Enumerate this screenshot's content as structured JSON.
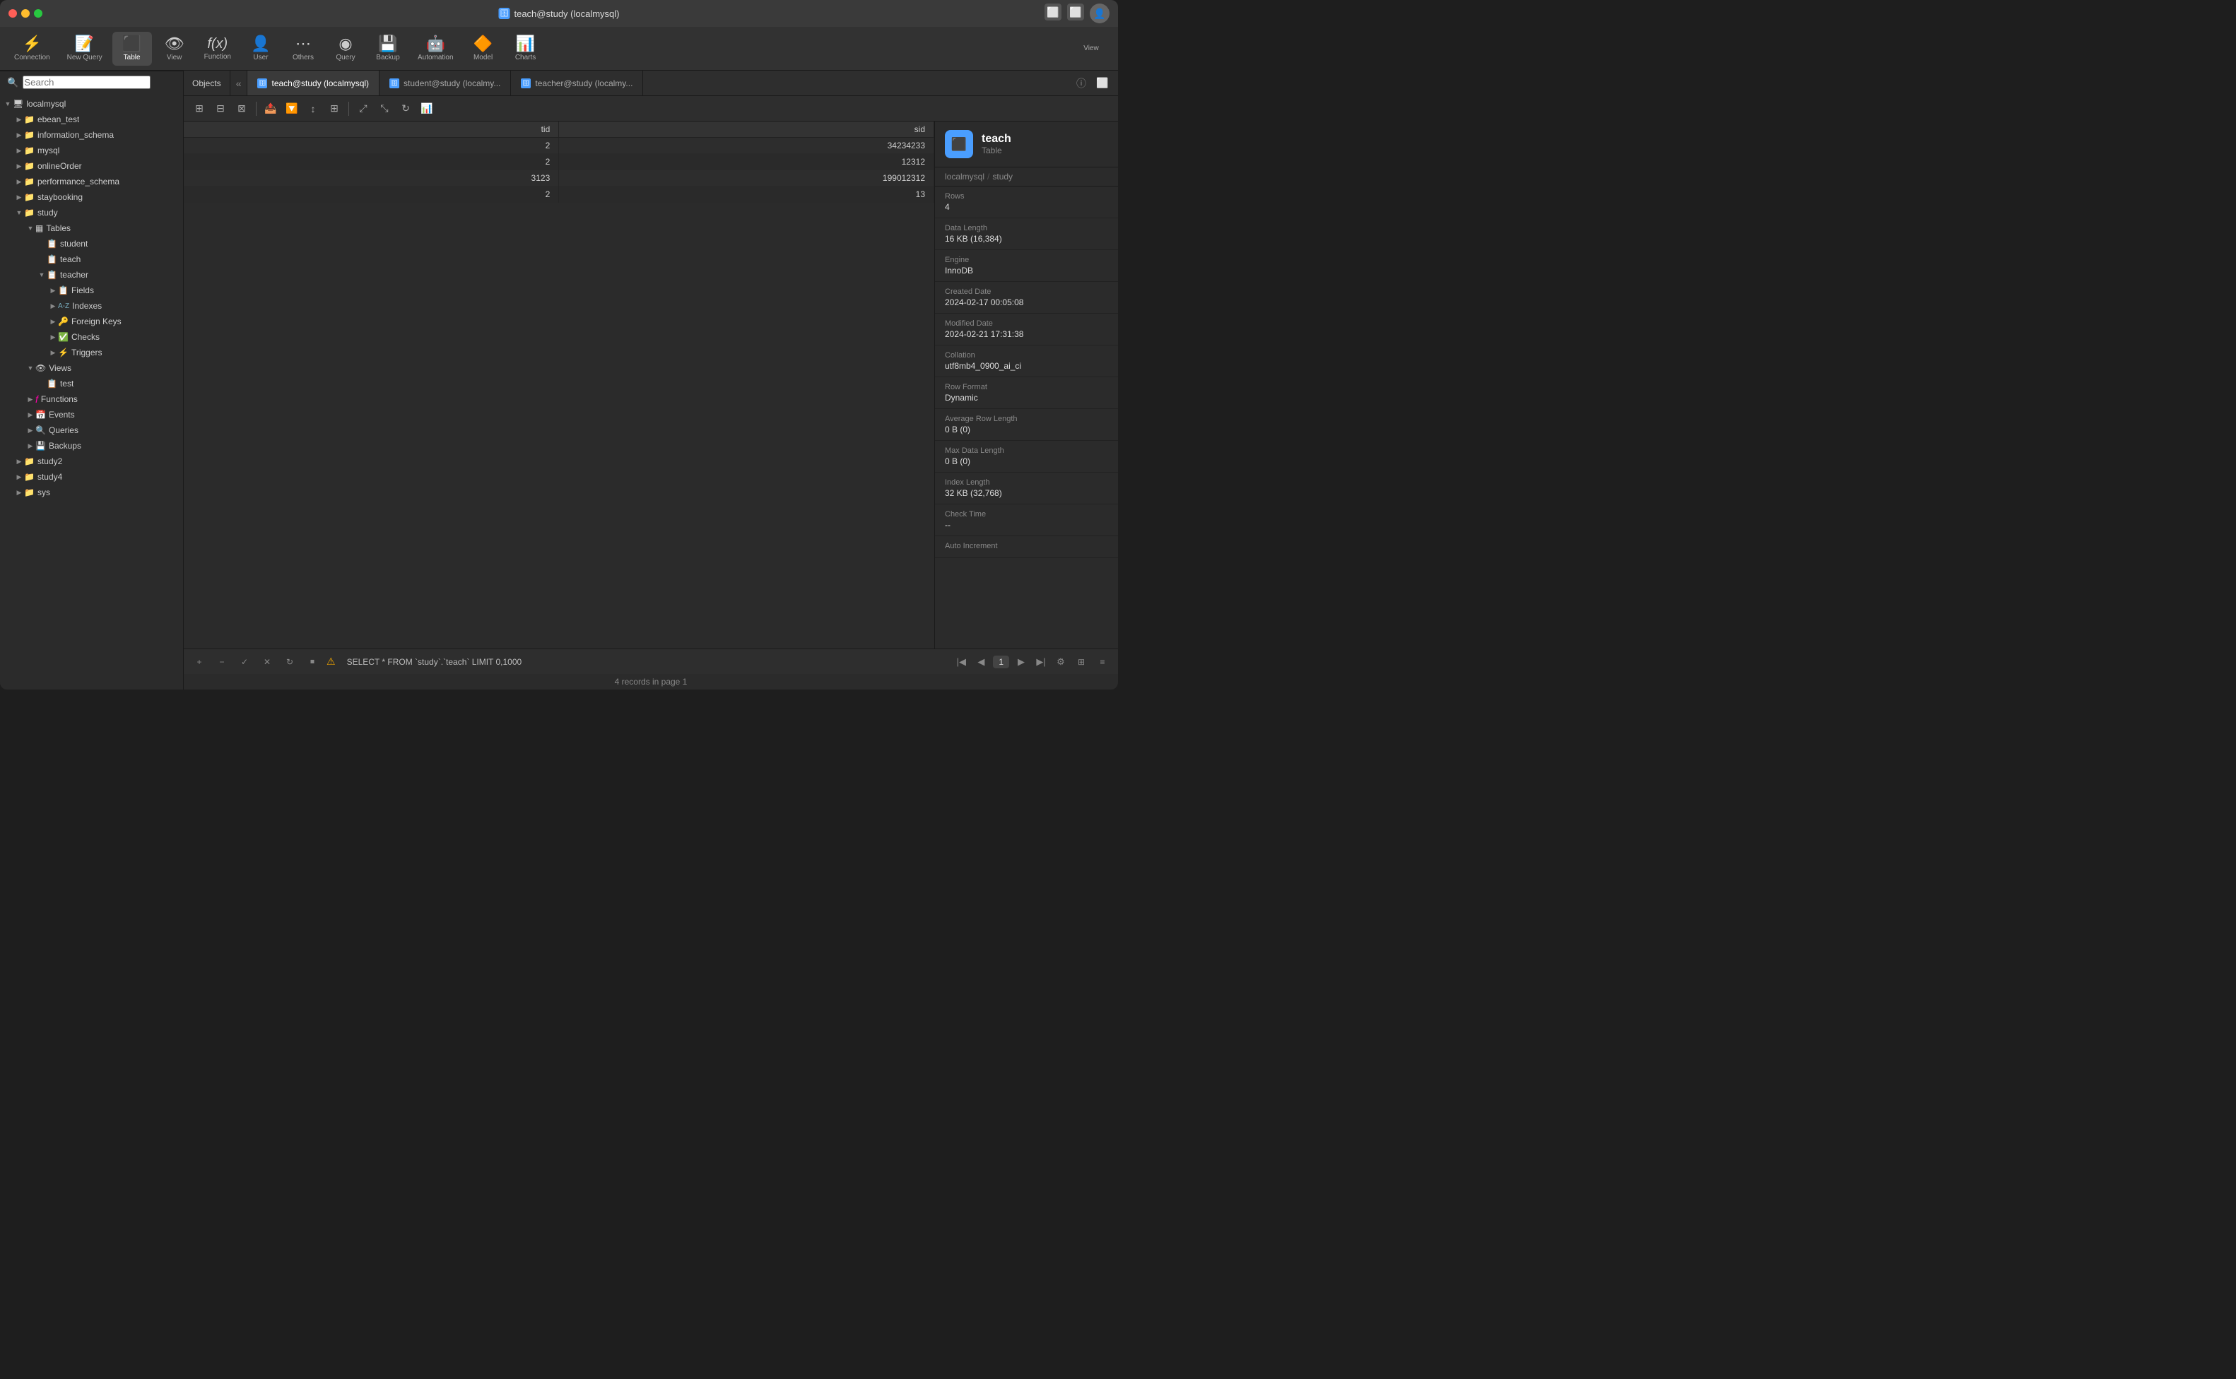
{
  "window": {
    "title": "teach@study (localmysql)"
  },
  "toolbar": {
    "items": [
      {
        "id": "connection",
        "label": "Connection",
        "icon": "⚡"
      },
      {
        "id": "new-query",
        "label": "New Query",
        "icon": "📝"
      },
      {
        "id": "table",
        "label": "Table",
        "icon": "▦",
        "active": true
      },
      {
        "id": "view",
        "label": "View",
        "icon": "👁"
      },
      {
        "id": "function",
        "label": "Function",
        "icon": "ƒ"
      },
      {
        "id": "user",
        "label": "User",
        "icon": "👤"
      },
      {
        "id": "others",
        "label": "Others",
        "icon": "⋯"
      },
      {
        "id": "query",
        "label": "Query",
        "icon": "◉"
      },
      {
        "id": "backup",
        "label": "Backup",
        "icon": "💾"
      },
      {
        "id": "automation",
        "label": "Automation",
        "icon": "🤖"
      },
      {
        "id": "model",
        "label": "Model",
        "icon": "🔶"
      },
      {
        "id": "charts",
        "label": "Charts",
        "icon": "📊"
      }
    ],
    "view_label": "View"
  },
  "tabs": {
    "objects_label": "Objects",
    "tabs": [
      {
        "id": "teach-study",
        "label": "teach@study (localmysql)",
        "active": true
      },
      {
        "id": "student-study",
        "label": "student@study (localmy..."
      },
      {
        "id": "teacher-study",
        "label": "teacher@study (localmy..."
      }
    ]
  },
  "sidebar": {
    "search_placeholder": "Search",
    "items": [
      {
        "id": "localmysql",
        "label": "localmysql",
        "level": 0,
        "expanded": true,
        "icon": "🖥"
      },
      {
        "id": "ebean_test",
        "label": "ebean_test",
        "level": 1,
        "expanded": false,
        "icon": "📁"
      },
      {
        "id": "information_schema",
        "label": "information_schema",
        "level": 1,
        "expanded": false,
        "icon": "📁"
      },
      {
        "id": "mysql",
        "label": "mysql",
        "level": 1,
        "expanded": false,
        "icon": "📁"
      },
      {
        "id": "onlineOrder",
        "label": "onlineOrder",
        "level": 1,
        "expanded": false,
        "icon": "📁"
      },
      {
        "id": "performance_schema",
        "label": "performance_schema",
        "level": 1,
        "expanded": false,
        "icon": "📁"
      },
      {
        "id": "staybooking",
        "label": "staybooking",
        "level": 1,
        "expanded": false,
        "icon": "📁"
      },
      {
        "id": "study",
        "label": "study",
        "level": 1,
        "expanded": true,
        "icon": "📁"
      },
      {
        "id": "tables",
        "label": "Tables",
        "level": 2,
        "expanded": true,
        "icon": "▦"
      },
      {
        "id": "student",
        "label": "student",
        "level": 3,
        "icon": "📋"
      },
      {
        "id": "teach",
        "label": "teach",
        "level": 3,
        "icon": "📋"
      },
      {
        "id": "teacher",
        "label": "teacher",
        "level": 3,
        "expanded": true,
        "icon": "📋"
      },
      {
        "id": "fields",
        "label": "Fields",
        "level": 4,
        "icon": "📋"
      },
      {
        "id": "indexes",
        "label": "Indexes",
        "level": 4,
        "icon": "🔤"
      },
      {
        "id": "foreign-keys",
        "label": "Foreign Keys",
        "level": 4,
        "icon": "🔑"
      },
      {
        "id": "checks",
        "label": "Checks",
        "level": 4,
        "icon": "✅"
      },
      {
        "id": "triggers",
        "label": "Triggers",
        "level": 4,
        "icon": "⚡"
      },
      {
        "id": "views",
        "label": "Views",
        "level": 2,
        "expanded": true,
        "icon": "👁"
      },
      {
        "id": "test",
        "label": "test",
        "level": 3,
        "icon": "📋"
      },
      {
        "id": "functions",
        "label": "Functions",
        "level": 2,
        "icon": "ƒ"
      },
      {
        "id": "events",
        "label": "Events",
        "level": 2,
        "icon": "📅"
      },
      {
        "id": "queries",
        "label": "Queries",
        "level": 2,
        "icon": "🔍"
      },
      {
        "id": "backups",
        "label": "Backups",
        "level": 2,
        "icon": "💾"
      },
      {
        "id": "study2",
        "label": "study2",
        "level": 1,
        "icon": "📁"
      },
      {
        "id": "study4",
        "label": "study4",
        "level": 1,
        "icon": "📁"
      },
      {
        "id": "sys",
        "label": "sys",
        "level": 1,
        "icon": "📁"
      }
    ]
  },
  "table": {
    "columns": [
      "tid",
      "sid"
    ],
    "rows": [
      {
        "tid": "2",
        "sid": "34234233"
      },
      {
        "tid": "2",
        "sid": "12312"
      },
      {
        "tid": "3123",
        "sid": "199012312"
      },
      {
        "tid": "2",
        "sid": "13"
      }
    ]
  },
  "info_panel": {
    "table_name": "teach",
    "table_type": "Table",
    "server": "localmysql",
    "database": "study",
    "rows_label": "Rows",
    "rows_value": "4",
    "data_length_label": "Data Length",
    "data_length_value": "16 KB (16,384)",
    "engine_label": "Engine",
    "engine_value": "InnoDB",
    "created_date_label": "Created Date",
    "created_date_value": "2024-02-17 00:05:08",
    "modified_date_label": "Modified Date",
    "modified_date_value": "2024-02-21 17:31:38",
    "collation_label": "Collation",
    "collation_value": "utf8mb4_0900_ai_ci",
    "row_format_label": "Row Format",
    "row_format_value": "Dynamic",
    "avg_row_length_label": "Average Row Length",
    "avg_row_length_value": "0 B (0)",
    "max_data_length_label": "Max Data Length",
    "max_data_length_value": "0 B (0)",
    "index_length_label": "Index Length",
    "index_length_value": "32 KB (32,768)",
    "check_time_label": "Check Time",
    "check_time_value": "--",
    "auto_increment_label": "Auto Increment",
    "auto_increment_value": ""
  },
  "status_bar": {
    "sql": "SELECT * FROM `study`.`teach` LIMIT 0,1000",
    "page": "1",
    "records": "4 records in page 1"
  }
}
